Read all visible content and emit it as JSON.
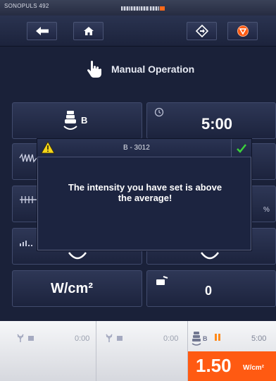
{
  "status": {
    "device": "SONOPULS 492"
  },
  "title": {
    "text": "Manual Operation"
  },
  "panels": {
    "head_label": "B",
    "time": "5:00",
    "unit_label": "W/cm²",
    "percent_symbol": "%",
    "counter": "0"
  },
  "dialog": {
    "code": "B - 3012",
    "message_line1": "The intensity you have set is above",
    "message_line2": "the average!"
  },
  "channels": [
    {
      "time": "0:00"
    },
    {
      "time": "0:00"
    },
    {
      "head_label": "B",
      "time": "5:00",
      "intensity": "1.50",
      "unit": "W/cm²"
    }
  ],
  "colors": {
    "accent_orange": "#ff5a12",
    "background": "#1a2139",
    "confirm_green": "#3bd23b",
    "warning_yellow": "#f6d61a"
  },
  "icons": [
    "back-arrow-icon",
    "home-icon",
    "navigate-icon",
    "stop-icon",
    "hand-pointer-icon",
    "ultrasound-head-icon",
    "clock-icon",
    "warning-icon",
    "check-icon",
    "rf-channel-icon",
    "pause-icon"
  ]
}
